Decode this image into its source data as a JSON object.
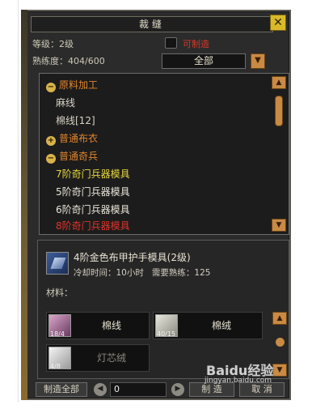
{
  "window": {
    "title": "裁缝",
    "close": "✕"
  },
  "stats": {
    "level": "等级：2级",
    "proficiency": "熟练度：404/600",
    "craftable_label": "可制造",
    "filter_value": "全部"
  },
  "tree": [
    {
      "kind": "cat",
      "symbol": "−",
      "label": "原料加工"
    },
    {
      "kind": "mat",
      "label": "麻线"
    },
    {
      "kind": "mat",
      "label": "棉线[12]"
    },
    {
      "kind": "cat",
      "symbol": "+",
      "label": "普通布衣"
    },
    {
      "kind": "cat",
      "symbol": "−",
      "label": "普通奇兵"
    },
    {
      "kind": "y",
      "label": "7阶奇门兵器模具"
    },
    {
      "kind": "w",
      "label": "5阶奇门兵器模具"
    },
    {
      "kind": "w",
      "label": "6阶奇门兵器模具"
    },
    {
      "kind": "r",
      "label": "8阶奇门兵器模具"
    }
  ],
  "detail": {
    "item_name": "4阶金色布甲护手模具(2级)",
    "cooldown": "冷却时间：10小时",
    "required": "需要熟练：125",
    "materials_label": "材料：",
    "materials": [
      {
        "name": "棉线",
        "count": "18/4"
      },
      {
        "name": "棉绒",
        "count": "40/15"
      },
      {
        "name": "灯芯绒",
        "count": "4/8"
      }
    ]
  },
  "footer": {
    "make_all": "制造全部",
    "quantity": "0",
    "make": "制 造",
    "cancel": "取 消"
  },
  "watermark": {
    "brand": "Baidu经验",
    "url": "jingyan.baidu.com"
  },
  "colors": {
    "category": "#e0852c",
    "yellow_item": "#e6d840",
    "red_item": "#e0342a",
    "accent_button": "#c98a45"
  }
}
